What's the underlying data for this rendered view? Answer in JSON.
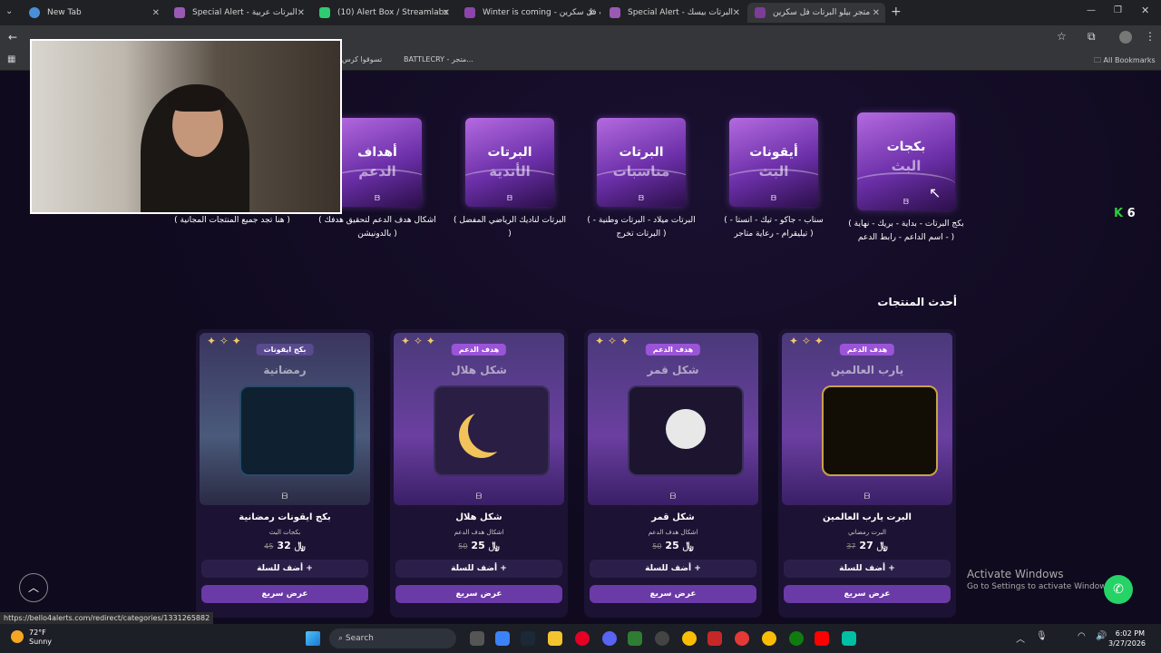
{
  "browser": {
    "tabs": [
      {
        "title": "New Tab",
        "color": "#4a90d9"
      },
      {
        "title": "Special Alert - البرتات عربية",
        "color": "#9b59b6"
      },
      {
        "title": "(10) Alert Box / Streamlabs",
        "color": "#2ecc71"
      },
      {
        "title": "Winter is coming - متجر بيلو البرتات فل سكرين",
        "color": "#8e44ad"
      },
      {
        "title": "Special Alert - البرتات بيسك",
        "color": "#9b59b6"
      },
      {
        "title": "متجر بيلو البرتات فل سكرين",
        "color": "#7d3c98"
      }
    ],
    "bookmarks": [
      {
        "label": "تسوقوا كرس"
      },
      {
        "label": "BATTLECRY - متجر..."
      }
    ],
    "all_bookmarks": "All Bookmarks"
  },
  "categories": [
    {
      "title": "بكجات",
      "subtitle": "البث",
      "desc": "( بكج البرتات - بداية - بريك - نهاية - اسم الداعم - رابط الدعم )"
    },
    {
      "title": "أيقونات",
      "subtitle": "البث",
      "desc": "( سناب - جاكو - تيك - انستا - تيليقرام - رعاية متاجر )"
    },
    {
      "title": "البرتات",
      "subtitle": "مناسبات",
      "desc": "( البرتات ميلاد - البرتات وطنية - البرتات تخرج )"
    },
    {
      "title": "البرتات",
      "subtitle": "الأندية",
      "desc": "( البرتات لناديك الرياضي المفضل )"
    },
    {
      "title": "أهداف",
      "subtitle": "الدعم",
      "desc": "( اشكال هدف الدعم لتحقيق هدفك بالدونيشن )"
    },
    {
      "desc": "( هنا تجد جميع المنتجات المجانية )"
    }
  ],
  "latest_title": "أحدث المنتجات",
  "kick_count": "6",
  "products": [
    {
      "tag": "هدف الدعم",
      "img_text": "يارب العالمين",
      "name": "البرت يارب العالمين",
      "category": "البرت رمضاني",
      "price": "27",
      "old_price": "37",
      "add": "أضف للسلة",
      "view": "عرض سريع"
    },
    {
      "tag": "هدف الدعم",
      "img_text": "شكل قمر",
      "name": "شكل قمر",
      "category": "اشكال هدف الدعم",
      "price": "25",
      "old_price": "50",
      "add": "أضف للسلة",
      "view": "عرض سريع"
    },
    {
      "tag": "هدف الدعم",
      "img_text": "شكل هلال",
      "name": "شكل هلال",
      "category": "اشكال هدف الدعم",
      "price": "25",
      "old_price": "50",
      "add": "أضف للسلة",
      "view": "عرض سريع"
    },
    {
      "tag": "بكج ايقونات",
      "img_text": "رمضانية",
      "name": "بكج ايقونات رمضانية",
      "category": "بكجات البث",
      "price": "32",
      "old_price": "45",
      "add": "أضف للسلة",
      "view": "عرض سريع"
    }
  ],
  "currency_symbol": "﷼",
  "watermark": {
    "line1": "Activate Windows",
    "line2": "Go to Settings to activate Windows."
  },
  "status_url": "https://bello4alerts.com/redirect/categories/1331265882",
  "taskbar": {
    "temp": "72°F",
    "weather": "Sunny",
    "search": "Search",
    "time": "6:02 PM",
    "date": "3/27/2026"
  }
}
